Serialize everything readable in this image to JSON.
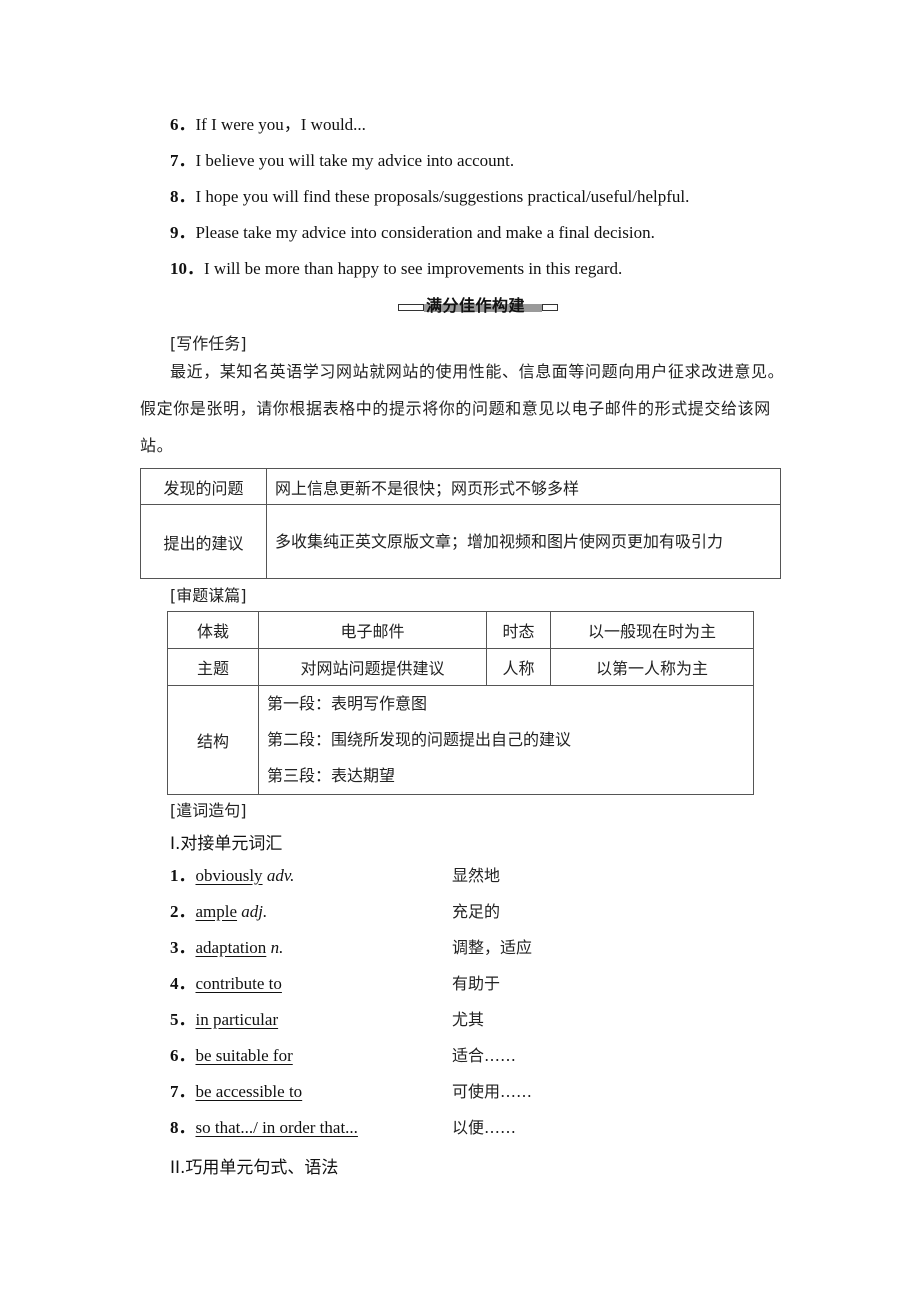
{
  "sentences": [
    {
      "num": "6．",
      "text": "If I were you，I would..."
    },
    {
      "num": "7．",
      "text": "I believe you will take my advice into account."
    },
    {
      "num": "8．",
      "text": "I hope you will find these proposals/suggestions practical/useful/helpful."
    },
    {
      "num": "9．",
      "text": "Please take my advice into consideration and make a final decision."
    },
    {
      "num": "10．",
      "text": "I will be more than happy to see improvements in this regard."
    }
  ],
  "section_heading": "满分佳作构建",
  "task": {
    "label": "[写作任务]",
    "paragraph": "最近，某知名英语学习网站就网站的使用性能、信息面等问题向用户征求改进意见。假定你是张明，请你根据表格中的提示将你的问题和意见以电子邮件的形式提交给该网站。"
  },
  "task_table": [
    {
      "label": "发现的问题",
      "value": "网上信息更新不是很快；网页形式不够多样"
    },
    {
      "label": "提出的建议",
      "value": "多收集纯正英文原版文章；增加视频和图片使网页更加有吸引力"
    }
  ],
  "analysis": {
    "label": "[审题谋篇]",
    "rows": [
      {
        "k1": "体裁",
        "v1": "电子邮件",
        "k2": "时态",
        "v2": "以一般现在时为主"
      },
      {
        "k1": "主题",
        "v1": "对网站问题提供建议",
        "k2": "人称",
        "v2": "以第一人称为主"
      }
    ],
    "structure_label": "结构",
    "structure": [
      "第一段：表明写作意图",
      "第二段：围绕所发现的问题提出自己的建议",
      "第三段：表达期望"
    ]
  },
  "wording": {
    "label": "[遣词造句]",
    "part1_title": "I.对接单元词汇",
    "vocab": [
      {
        "num": "1．",
        "term": "obviously",
        "pos": "adv.",
        "meaning": "显然地"
      },
      {
        "num": "2．",
        "term": "ample",
        "pos": "adj.",
        "meaning": "充足的"
      },
      {
        "num": "3．",
        "term": "adaptation",
        "pos": "n.",
        "meaning": "调整，适应"
      },
      {
        "num": "4．",
        "term": "contribute to",
        "pos": "",
        "meaning": "有助于"
      },
      {
        "num": "5．",
        "term": "in particular",
        "pos": "",
        "meaning": "尤其"
      },
      {
        "num": "6．",
        "term": "be suitable for",
        "pos": "",
        "meaning": "适合……"
      },
      {
        "num": "7．",
        "term": "be accessible to",
        "pos": "",
        "meaning": "可使用……"
      },
      {
        "num": "8．",
        "term": "so that.../ in order that...",
        "pos": "",
        "meaning": "以便……"
      }
    ],
    "part2_title": "II.巧用单元句式、语法"
  }
}
